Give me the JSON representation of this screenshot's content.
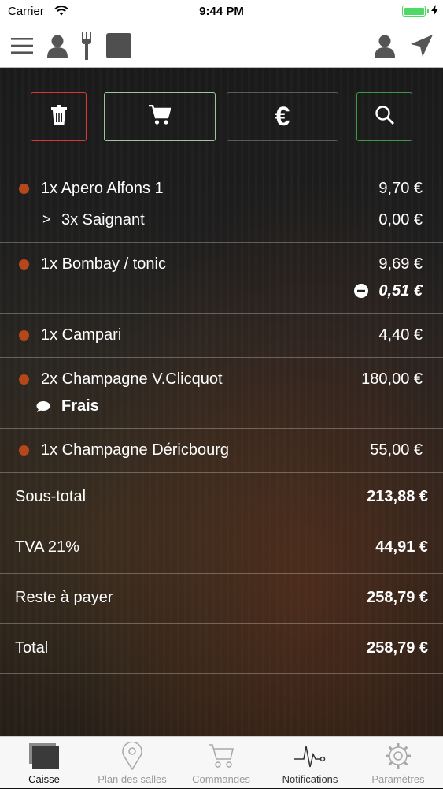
{
  "status_bar": {
    "carrier": "Carrier",
    "time": "9:44 PM"
  },
  "nav": {
    "left_icons": [
      "menu-icon",
      "user-icon",
      "fork-icon",
      "square-icon"
    ],
    "right_icons": [
      "user-icon",
      "send-icon"
    ]
  },
  "toolbar": {
    "buttons": [
      {
        "icon": "trash-icon",
        "border_color": "#d9382f"
      },
      {
        "icon": "cart-icon",
        "border_color": "#9bc59b"
      },
      {
        "icon": "euro-icon",
        "border_color": "#5a5a5a"
      },
      {
        "icon": "search-icon",
        "border_color": "#3a9a48"
      }
    ],
    "euro_symbol": "€"
  },
  "order": {
    "items": [
      {
        "name": "1x Apero Alfons 1",
        "price": "9,70 €",
        "sub": {
          "chevron": ">",
          "name": "3x Saignant",
          "price": "0,00 €"
        }
      },
      {
        "name": "1x Bombay / tonic",
        "price": "9,69 €",
        "discount": "0,51 €"
      },
      {
        "name": "1x Campari",
        "price": "4,40 €"
      },
      {
        "name": "2x Champagne V.Clicquot",
        "price": "180,00 €",
        "comment": "Frais"
      },
      {
        "name": "1x Champagne Déricbourg",
        "price": "55,00 €"
      }
    ],
    "dot_color": "#b5471a"
  },
  "totals": {
    "subtotal": {
      "label": "Sous-total",
      "value": "213,88 €"
    },
    "tva": {
      "label": "TVA 21%",
      "value": "44,91 €"
    },
    "remaining": {
      "label": "Reste à payer",
      "value": "258,79 €"
    },
    "total": {
      "label": "Total",
      "value": "258,79 €"
    }
  },
  "tabs": [
    {
      "label": "Caisse",
      "icon": "register-icon",
      "active": true
    },
    {
      "label": "Plan des salles",
      "icon": "map-pin-icon",
      "active": false
    },
    {
      "label": "Commandes",
      "icon": "cart-icon",
      "active": false
    },
    {
      "label": "Notifications",
      "icon": "pulse-icon",
      "active": false
    },
    {
      "label": "Paramètres",
      "icon": "gear-icon",
      "active": false
    }
  ]
}
